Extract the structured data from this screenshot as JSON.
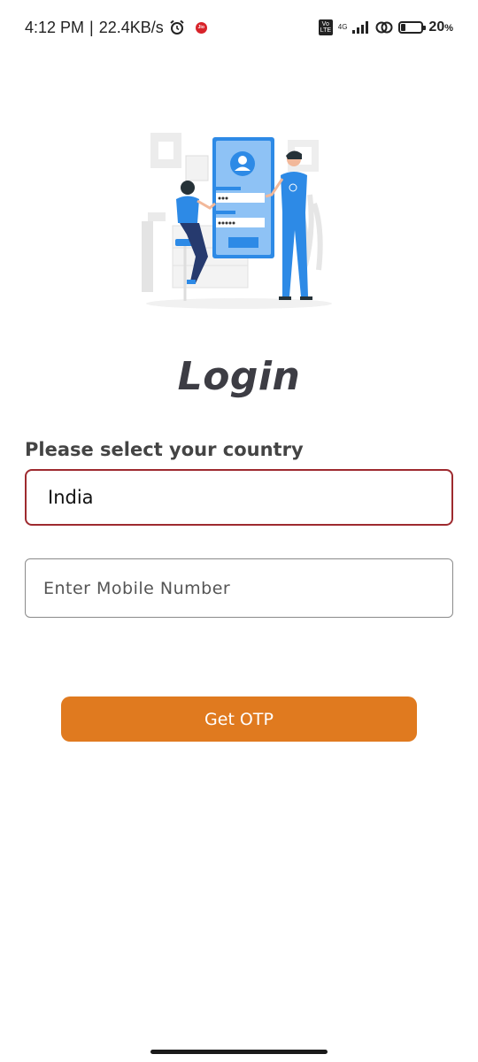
{
  "status_bar": {
    "time": "4:12 PM",
    "separator": "|",
    "speed": "22.4KB/s",
    "jio_label": "Jio",
    "volte_label": "Vo LTE",
    "network_type": "4G",
    "battery_percent": "20",
    "battery_suffix": "%",
    "battery_level": 0.2
  },
  "illustration": {
    "icon": "login-illustration"
  },
  "login": {
    "title": "Login",
    "country_label": "Please select your country",
    "country_value": "India",
    "mobile_placeholder": "Enter Mobile Number",
    "mobile_value": "",
    "otp_button": "Get OTP"
  },
  "colors": {
    "accent": "#e07a1f",
    "country_border": "#9e2a2f",
    "illustration_blue": "#2d8ae6"
  }
}
